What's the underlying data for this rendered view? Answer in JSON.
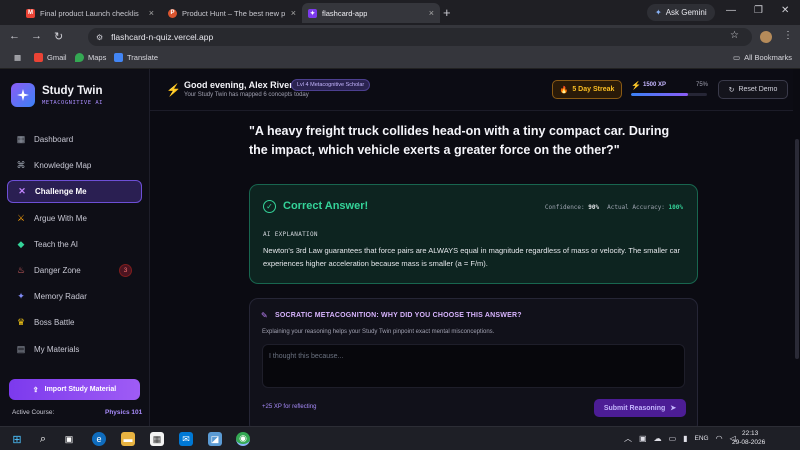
{
  "browser": {
    "tabs": [
      {
        "title": "Final product Launch checklis",
        "favicon": "gmail-icon",
        "active": false
      },
      {
        "title": "Product Hunt – The best new p",
        "favicon": "producthunt-icon",
        "active": false
      },
      {
        "title": "flashcard-app",
        "favicon": "app-icon",
        "active": true
      }
    ],
    "new_tab": "+",
    "ask_gemini": "Ask Gemini",
    "url": "flashcard-n-quiz.vercel.app",
    "bookmarks": [
      {
        "label": "Gmail",
        "color": "#ea4335"
      },
      {
        "label": "Maps",
        "color": "#34a853"
      },
      {
        "label": "Translate",
        "color": "#4285f4"
      }
    ],
    "all_bookmarks": "All Bookmarks"
  },
  "sidebar": {
    "brand_title": "Study Twin",
    "brand_sub": "METACOGNITIVE AI",
    "items": [
      {
        "label": "Dashboard",
        "icon": "grid-icon",
        "glyph": "▦",
        "color": "#9ca3af",
        "active": false
      },
      {
        "label": "Knowledge Map",
        "icon": "network-icon",
        "glyph": "⌘",
        "color": "#9ca3af",
        "active": false
      },
      {
        "label": "Challenge Me",
        "icon": "crossed-swords-icon",
        "glyph": "✕",
        "color": "#c084fc",
        "active": true
      },
      {
        "label": "Argue With Me",
        "icon": "argue-icon",
        "glyph": "⚔",
        "color": "#f59e0b",
        "active": false
      },
      {
        "label": "Teach the AI",
        "icon": "graduation-cap-icon",
        "glyph": "◆",
        "color": "#34d399",
        "active": false
      },
      {
        "label": "Danger Zone",
        "icon": "flame-icon",
        "glyph": "♨",
        "color": "#f87171",
        "active": false,
        "badge": "3"
      },
      {
        "label": "Memory Radar",
        "icon": "radar-icon",
        "glyph": "✦",
        "color": "#818cf8",
        "active": false
      },
      {
        "label": "Boss Battle",
        "icon": "trophy-icon",
        "glyph": "♛",
        "color": "#facc15",
        "active": false
      },
      {
        "label": "My Materials",
        "icon": "book-icon",
        "glyph": "▤",
        "color": "#9ca3af",
        "active": false
      }
    ],
    "import_button": "Import Study Material",
    "active_course_label": "Active Course:",
    "active_course_value": "Physics 101"
  },
  "header": {
    "greeting": "Good evening, Alex Rivera",
    "level_badge": "Lvl 4 Metacognitive Scholar",
    "subtitle": "Your Study Twin has mapped 6 concepts today",
    "streak": "5 Day Streak",
    "xp_label": "1500 XP",
    "xp_percent": "75%",
    "xp_fraction": 0.75,
    "reset_button": "Reset Demo"
  },
  "main": {
    "question": "\"A heavy freight truck collides head-on with a tiny compact car. During the impact, which vehicle exerts a greater force on the other?\"",
    "result": {
      "title": "Correct Answer!",
      "confidence_label": "Confidence:",
      "confidence_value": "90%",
      "accuracy_label": "Actual Accuracy:",
      "accuracy_value": "100%",
      "explanation_label": "AI EXPLANATION",
      "explanation": "Newton's 3rd Law guarantees that force pairs are ALWAYS equal in magnitude regardless of mass or velocity. The smaller car experiences higher acceleration because mass is smaller (a = F/m)."
    },
    "socratic": {
      "title": "SOCRATIC METACOGNITION: WHY DID YOU CHOOSE THIS ANSWER?",
      "subtitle": "Explaining your reasoning helps your Study Twin pinpoint exact mental misconceptions.",
      "input_value": "",
      "input_placeholder": "I thought this because...",
      "xp_note": "+25 XP for reflecting",
      "submit_button": "Submit Reasoning"
    }
  },
  "taskbar": {
    "lang": "ENG",
    "time": "22:13",
    "date": "29-08-2026"
  }
}
